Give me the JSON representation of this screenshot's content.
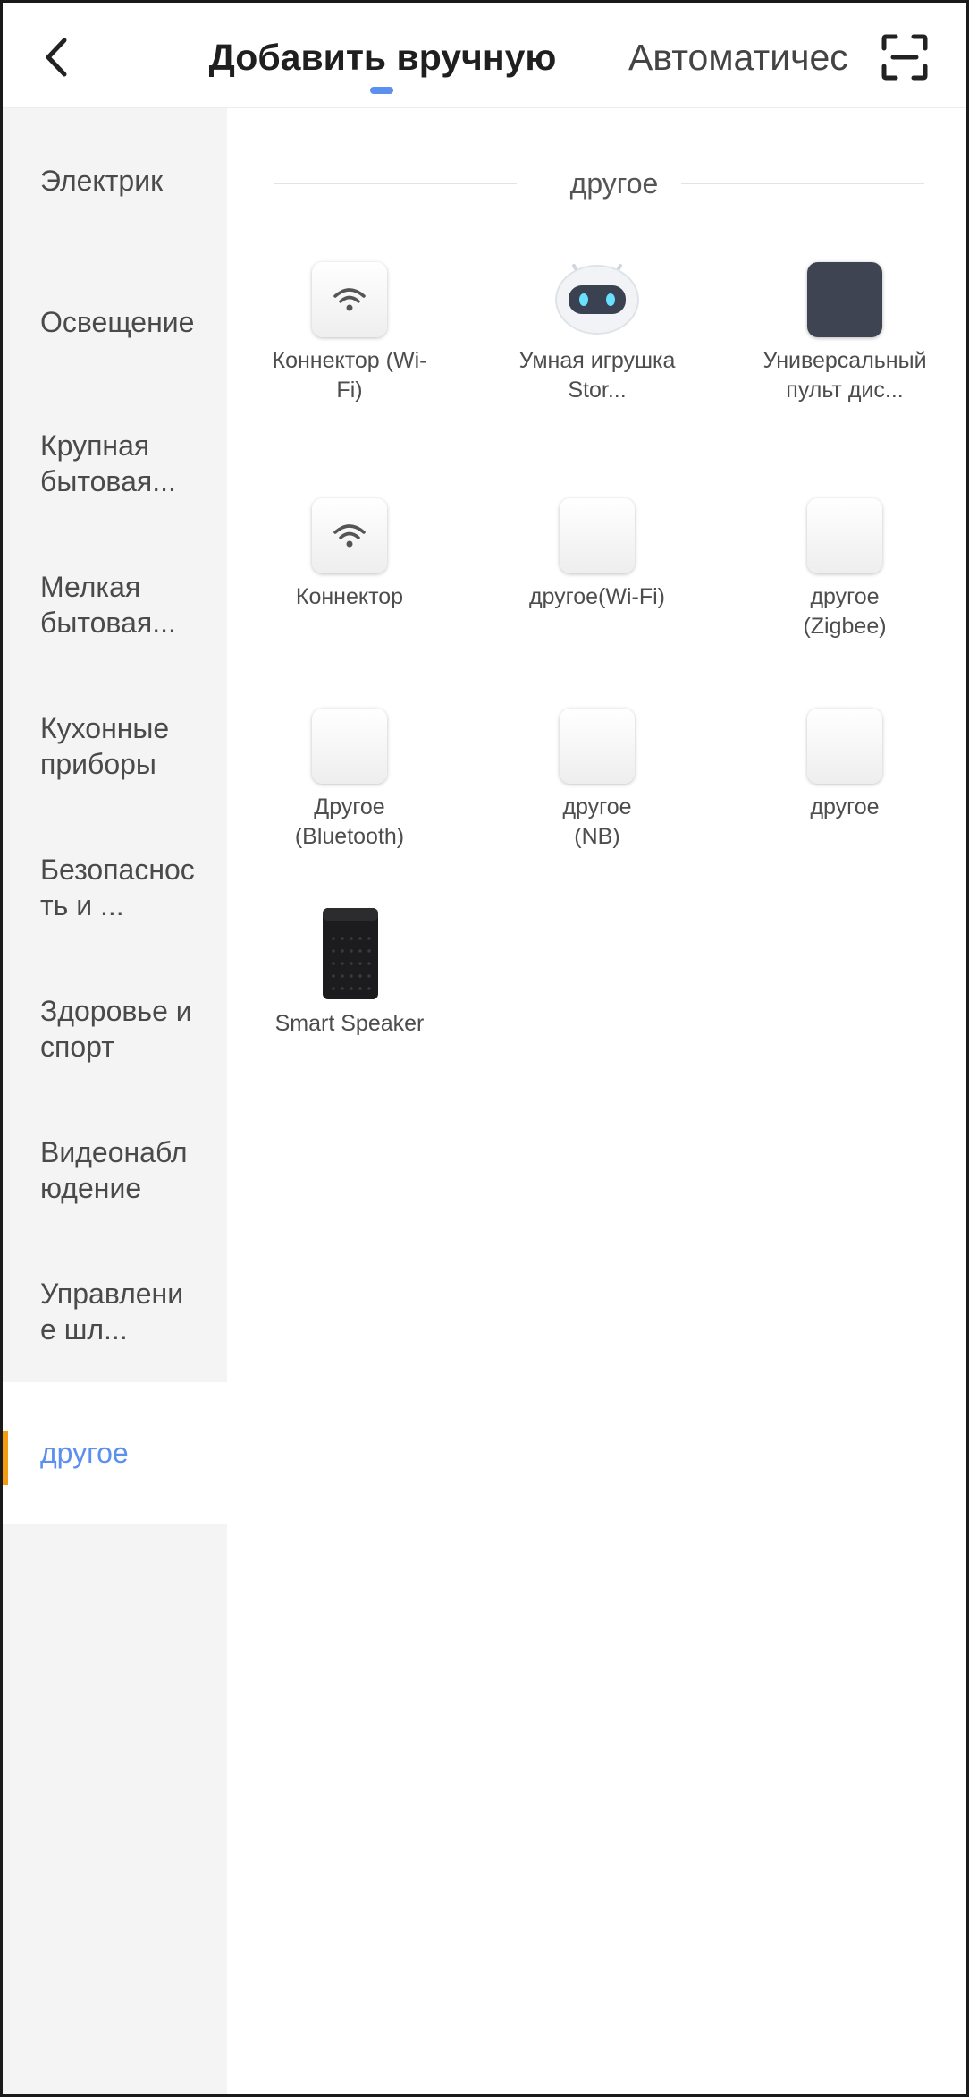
{
  "header": {
    "tab_manual": "Добавить вручную",
    "tab_auto": "Автоматичес",
    "active_tab_color": "#5b8ff0"
  },
  "sidebar": {
    "items": [
      {
        "label": "Электрик"
      },
      {
        "label": "Освещение"
      },
      {
        "label": "Крупная бытовая..."
      },
      {
        "label": "Мелкая бытовая..."
      },
      {
        "label": "Кухонные приборы"
      },
      {
        "label": "Безопасность и ..."
      },
      {
        "label": "Здоровье и спорт"
      },
      {
        "label": "Видеонаблюдение"
      },
      {
        "label": "Управление шл..."
      },
      {
        "label": "другое",
        "active": true
      }
    ],
    "active_color": "#5b8ff0",
    "marker_color": "#f39c12"
  },
  "main": {
    "section_title": "другое",
    "devices": [
      {
        "label": "Коннектор (Wi-Fi)",
        "icon": "wifi-icon"
      },
      {
        "label": "Умная игрушка Stor...",
        "icon": "robot-toy-icon"
      },
      {
        "label": "Универсальный пульт дис...",
        "icon": "remote-hub-icon"
      },
      {
        "label": "Коннектор",
        "icon": "wifi-icon"
      },
      {
        "label": "другое(Wi-Fi)",
        "icon": "blank-device-icon"
      },
      {
        "label": "другое (Zigbee)",
        "icon": "blank-device-icon"
      },
      {
        "label": "Другое (Bluetooth)",
        "icon": "blank-device-icon"
      },
      {
        "label": "другое (NB)",
        "icon": "blank-device-icon"
      },
      {
        "label": "другое",
        "icon": "blank-device-icon"
      },
      {
        "label": "Smart Speaker",
        "icon": "speaker-icon"
      }
    ]
  }
}
